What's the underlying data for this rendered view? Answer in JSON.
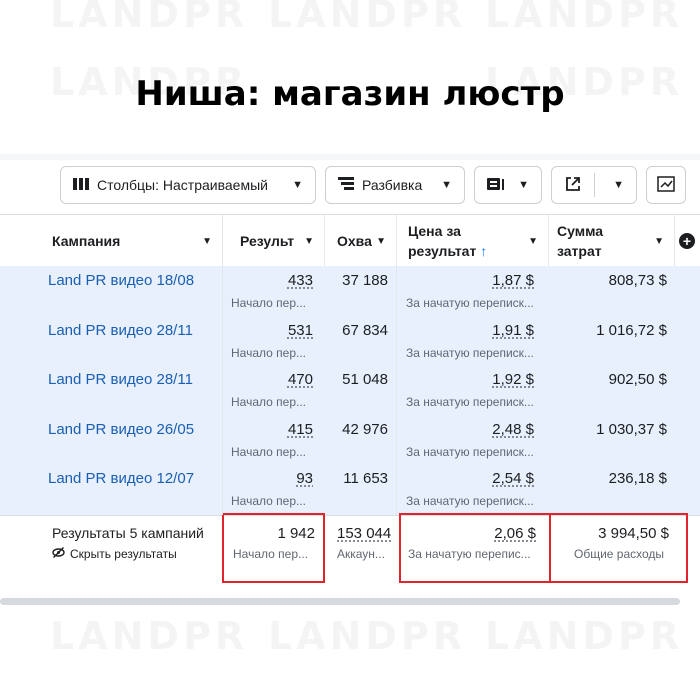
{
  "watermark": "LANDPR",
  "title": "Ниша: магазин люстр",
  "toolbar": {
    "columns_label": "Столбцы: Настраиваемый",
    "breakdown_label": "Разбивка"
  },
  "columns": {
    "campaign": "Кампания",
    "results": "Результ",
    "reach": "Охва",
    "cost_per_result_line1": "Цена за",
    "cost_per_result_line2": "результат",
    "sort_arrow": "↑",
    "amount_spent_line1": "Сумма",
    "amount_spent_line2": "затрат"
  },
  "rows": [
    {
      "campaign": "Land PR видео 18/08",
      "results": "433",
      "results_sub": "Начало пер...",
      "reach": "37 188",
      "cost": "1,87 $",
      "cost_sub": "За начатую переписк...",
      "spent": "808,73 $"
    },
    {
      "campaign": "Land PR видео 28/11",
      "results": "531",
      "results_sub": "Начало пер...",
      "reach": "67 834",
      "cost": "1,91 $",
      "cost_sub": "За начатую переписк...",
      "spent": "1 016,72 $"
    },
    {
      "campaign": "Land PR видео 28/11",
      "results": "470",
      "results_sub": "Начало пер...",
      "reach": "51 048",
      "cost": "1,92 $",
      "cost_sub": "За начатую переписк...",
      "spent": "902,50 $"
    },
    {
      "campaign": "Land PR видео 26/05",
      "results": "415",
      "results_sub": "Начало пер...",
      "reach": "42 976",
      "cost": "2,48 $",
      "cost_sub": "За начатую переписк...",
      "spent": "1 030,37 $"
    },
    {
      "campaign": "Land PR видео 12/07",
      "results": "93",
      "results_sub": "Начало пер...",
      "reach": "11 653",
      "cost": "2,54 $",
      "cost_sub": "За начатую переписк...",
      "spent": "236,18 $"
    }
  ],
  "totals": {
    "label": "Результаты 5 кампаний",
    "hide_label": "Скрыть результаты",
    "results": "1 942",
    "results_sub": "Начало пер...",
    "reach": "153 044",
    "reach_sub": "Аккаун...",
    "cost": "2,06 $",
    "cost_sub": "За начатую перепис...",
    "spent": "3 994,50 $",
    "spent_sub": "Общие расходы"
  },
  "colors": {
    "link": "#1a5fb4",
    "row_bg": "#e7f0fc",
    "highlight": "#e0242b"
  },
  "icons": [
    "columns-icon",
    "breakdown-icon",
    "reports-icon",
    "export-icon",
    "chart-icon",
    "eye-slash-icon"
  ]
}
